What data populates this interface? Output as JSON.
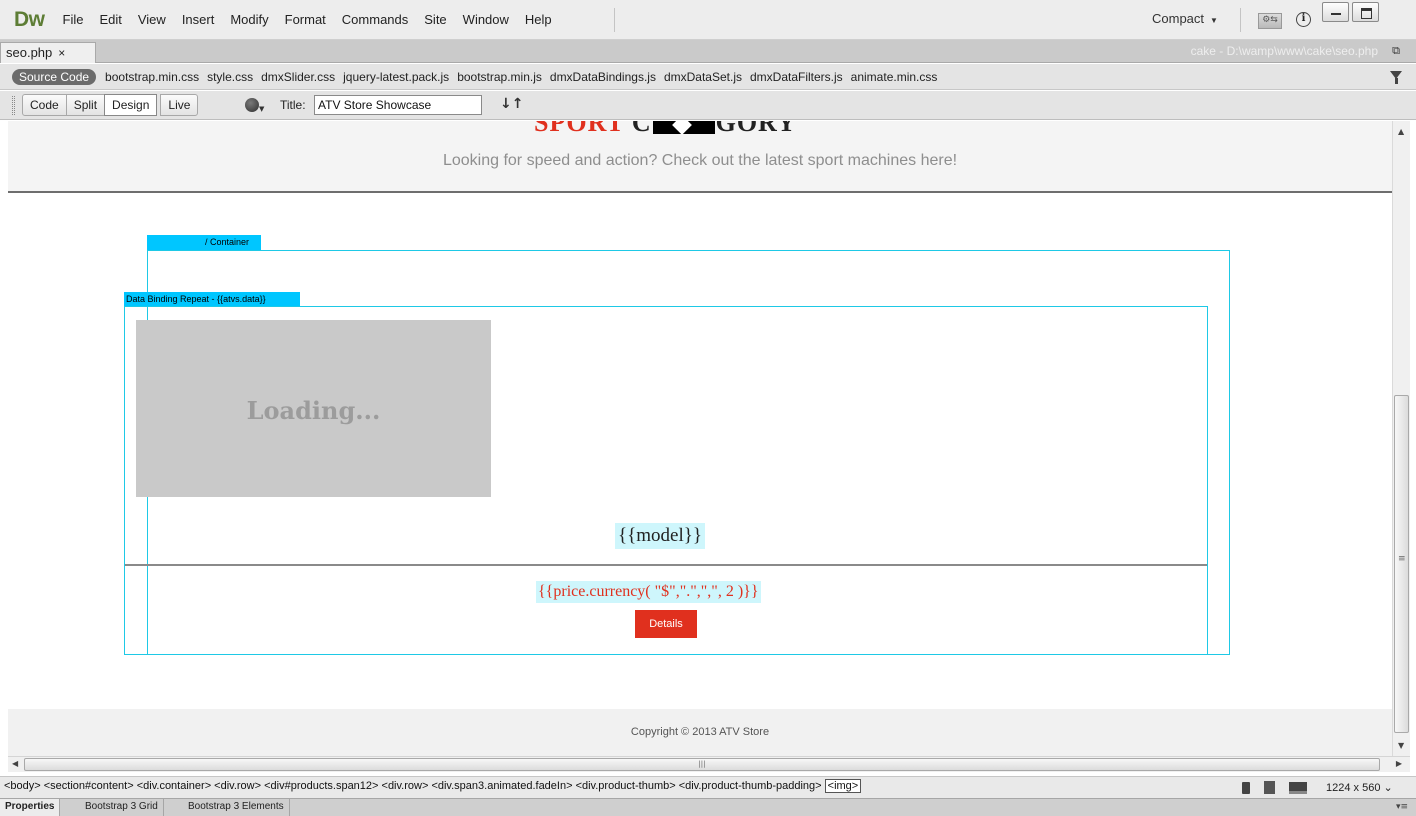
{
  "app": {
    "logo": "Dw",
    "menu": [
      "File",
      "Edit",
      "View",
      "Insert",
      "Modify",
      "Format",
      "Commands",
      "Site",
      "Window",
      "Help"
    ],
    "workspace": "Compact"
  },
  "document": {
    "tab_name": "seo.php",
    "tab_close": "×",
    "path": "cake - D:\\wamp\\www\\cake\\seo.php"
  },
  "related_files": {
    "source_code": "Source Code",
    "files": [
      "bootstrap.min.css",
      "style.css",
      "dmxSlider.css",
      "jquery-latest.pack.js",
      "bootstrap.min.js",
      "dmxDataBindings.js",
      "dmxDataSet.js",
      "dmxDataFilters.js",
      "animate.min.css"
    ]
  },
  "toolbar": {
    "views": [
      "Code",
      "Split",
      "Design"
    ],
    "live": "Live",
    "active_view": "Design",
    "title_label": "Title:",
    "title_value": "ATV Store Showcase"
  },
  "canvas": {
    "heading_red": "SPORT",
    "heading_c": "C",
    "heading_rest": "GORY",
    "subheading": "Looking for speed and action? Check out the latest sport machines here!",
    "container_label": "/ Container",
    "repeat_label": "Data Binding Repeat - {{atvs.data}}",
    "loading_text": "Loading...",
    "model_binding": "{{model}}",
    "price_binding": "{{price.currency( \"$\",\".\",\",\", 2 )}}",
    "details_button": "Details",
    "footer": "Copyright © 2013 ATV Store"
  },
  "status": {
    "tag_path": "<body> <section#content> <div.container> <div.row> <div#products.span12> <div.row> <div.span3.animated.fadeIn> <div.product-thumb> <div.product-thumb-padding>",
    "selected_tag": "<img>",
    "dimensions": "1224 x 560",
    "dimensions_arrow": "⌄"
  },
  "panels": [
    "Properties",
    "Bootstrap 3 Grid",
    "Bootstrap 3 Elements"
  ],
  "colors": {
    "accent_red": "#e0301e",
    "binding_cyan": "#00c6ff",
    "dw_green": "#5d7d35"
  }
}
